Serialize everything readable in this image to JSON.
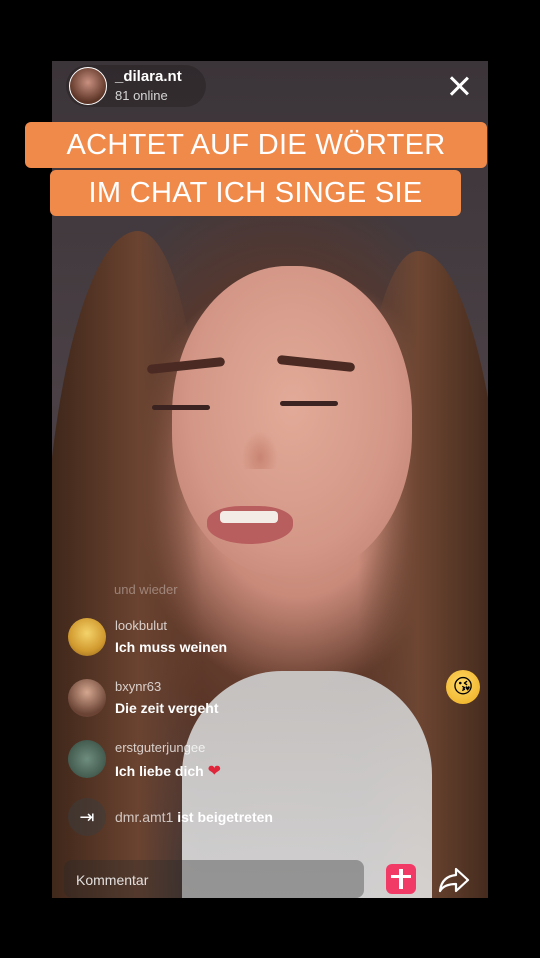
{
  "host": {
    "username": "_dilara.nt",
    "online": "81 online"
  },
  "caption": {
    "line1": "ACHTET AUF DIE WÖRTER",
    "line2": "IM CHAT ICH SINGE SIE"
  },
  "chat": {
    "faded_text": "und wieder",
    "messages": [
      {
        "user": "lookbulut",
        "text": "Ich muss weinen"
      },
      {
        "user": "bxynr63",
        "text": "Die zeit vergeht"
      },
      {
        "user": "erstguterjungee",
        "text": "Ich liebe dich",
        "emoji": "❤"
      }
    ],
    "join": {
      "user": "dmr.amt1",
      "text": " ist beigetreten"
    }
  },
  "bottom": {
    "comment_placeholder": "Kommentar"
  },
  "icons": {
    "close": "close-icon",
    "gift": "gift-icon",
    "share": "share-icon",
    "join": "enter-icon",
    "reaction": "kiss-emoji-icon"
  },
  "colors": {
    "caption_bg": "#f08a4b",
    "gift_bg": "#f23a66",
    "heart": "#e0243a"
  }
}
